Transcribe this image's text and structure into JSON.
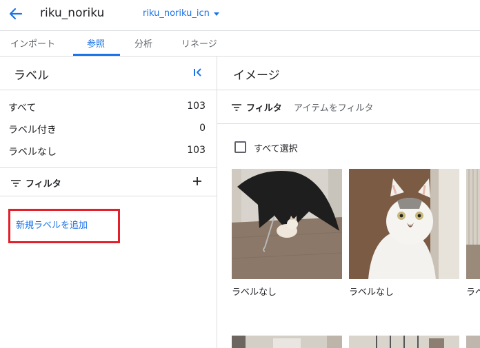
{
  "header": {
    "title": "riku_noriku",
    "dataset": "riku_noriku_icn"
  },
  "tabs": [
    {
      "label": "インポート"
    },
    {
      "label": "参照"
    },
    {
      "label": "分析"
    },
    {
      "label": "リネージ"
    }
  ],
  "labels_panel": {
    "title": "ラベル",
    "rows": [
      {
        "label": "すべて",
        "count": "103"
      },
      {
        "label": "ラベル付き",
        "count": "0"
      },
      {
        "label": "ラベルなし",
        "count": "103"
      }
    ],
    "filter_label": "フィルタ",
    "add_label": "新規ラベルを追加"
  },
  "images_panel": {
    "title": "イメージ",
    "filter_label": "フィルタ",
    "filter_placeholder": "アイテムをフィルタ",
    "select_all": "すべて選択",
    "items": [
      {
        "caption": "ラベルなし"
      },
      {
        "caption": "ラベルなし"
      },
      {
        "caption": "ラベ"
      }
    ]
  },
  "colors": {
    "accent": "#1a73e8",
    "highlight": "#e3202a",
    "divider": "#dadce0"
  }
}
